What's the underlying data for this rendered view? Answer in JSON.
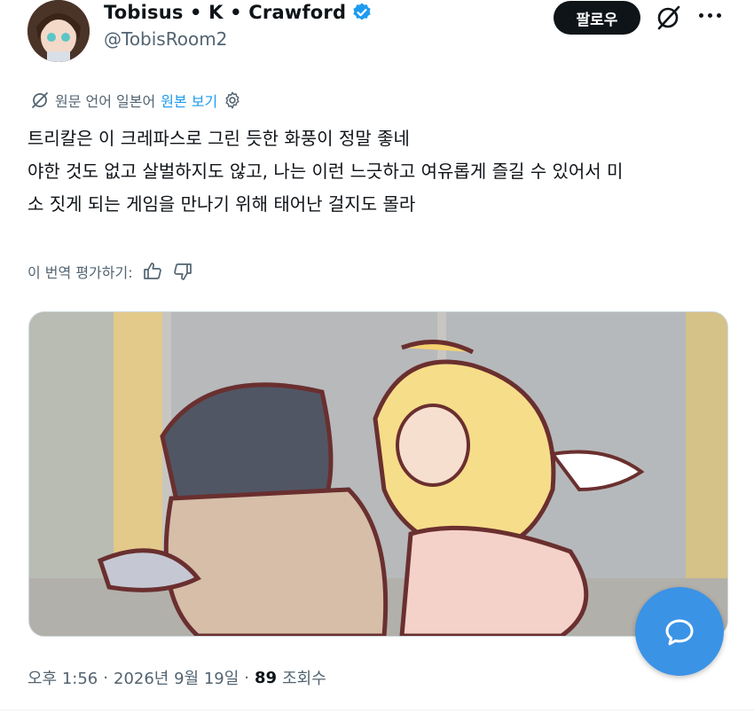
{
  "author": {
    "display_name": "Tobisus • K • Crawford",
    "handle": "@TobisRoom2"
  },
  "follow_label": "팔로우",
  "translation": {
    "source_text": "원문 언어 일본어",
    "view_original": "원본 보기"
  },
  "tweet": {
    "lines": [
      "트리칼은 이 크레파스로 그린 듯한 화풍이 정말 좋네",
      "야한 것도 없고 살벌하지도 않고, 나는 이런 느긋하고 여유롭게 즐길 수 있어서 미",
      "소 짓게 되는 게임을 만나기 위해 태어난 걸지도 몰라"
    ]
  },
  "rate_translation": "이 번역 평가하기:",
  "meta": {
    "time": "오후 1:56",
    "sep1": "·",
    "date": "2026년 9월 19일",
    "sep2": "·",
    "views_count": "89",
    "views_label": "조회수"
  },
  "colors": {
    "link": "#1d9bf0",
    "secondary_text": "#536471",
    "fab": "#3b93e6",
    "verified": "#1d9bf0"
  },
  "icons": {
    "verified": "verified-badge-icon",
    "grok": "grok-icon",
    "more": "more-icon",
    "translate": "translate-globe-icon",
    "settings": "gear-icon",
    "thumbs_up": "thumbs-up-icon",
    "thumbs_down": "thumbs-down-icon",
    "reply": "reply-bubble-icon"
  }
}
